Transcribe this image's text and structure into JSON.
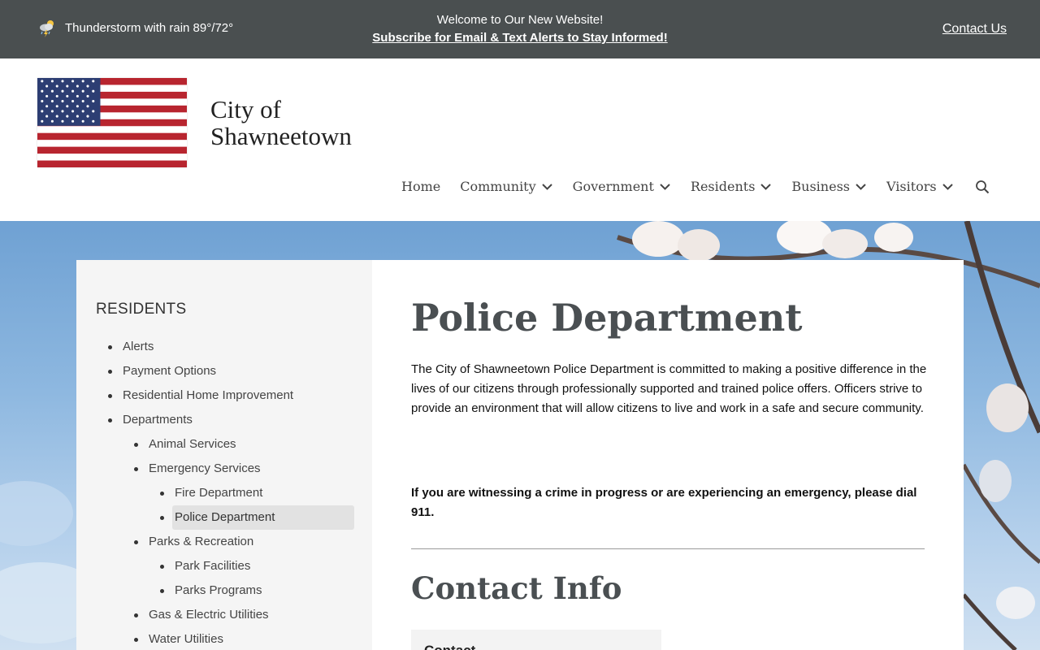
{
  "topbar": {
    "weather_text": "Thunderstorm with rain 89°/72°",
    "weather_icon": "thunderstorm-icon",
    "welcome": "Welcome to Our New Website!",
    "subscribe": "Subscribe for Email & Text Alerts to Stay Informed!",
    "contact": "Contact Us",
    "bg_color": "#4a4f50"
  },
  "header": {
    "site_name_line1": "City of",
    "site_name_line2": "Shawneetown",
    "logo": "american-flag"
  },
  "nav": {
    "items": [
      {
        "label": "Home",
        "dropdown": false
      },
      {
        "label": "Community",
        "dropdown": true
      },
      {
        "label": "Government",
        "dropdown": true
      },
      {
        "label": "Residents",
        "dropdown": true
      },
      {
        "label": "Business",
        "dropdown": true
      },
      {
        "label": "Visitors",
        "dropdown": true
      }
    ],
    "search_icon": "search-icon"
  },
  "sidebar": {
    "title": "RESIDENTS",
    "items": [
      {
        "label": "Alerts",
        "level": 1
      },
      {
        "label": "Payment Options",
        "level": 1
      },
      {
        "label": "Residential Home Improvement",
        "level": 1
      },
      {
        "label": "Departments",
        "level": 1
      },
      {
        "label": "Animal Services",
        "level": 2
      },
      {
        "label": "Emergency Services",
        "level": 2
      },
      {
        "label": "Fire Department",
        "level": 3
      },
      {
        "label": "Police Department",
        "level": 3,
        "active": true
      },
      {
        "label": "Parks & Recreation",
        "level": 2
      },
      {
        "label": "Park Facilities",
        "level": 3
      },
      {
        "label": "Parks Programs",
        "level": 3
      },
      {
        "label": "Gas & Electric Utilities",
        "level": 2
      },
      {
        "label": "Water Utilities",
        "level": 2
      }
    ]
  },
  "main": {
    "title": "Police Department",
    "intro": "The City of Shawneetown Police Department is committed to making a positive difference in the lives of our citizens through professionally supported and trained police offers. Officers strive to provide an environment that will allow citizens to live and work in a safe and secure community.",
    "emergency": "If you are witnessing a crime in progress or are experiencing an emergency, please dial 911.",
    "contact_heading": "Contact Info",
    "contact_card_title": "Contact"
  }
}
